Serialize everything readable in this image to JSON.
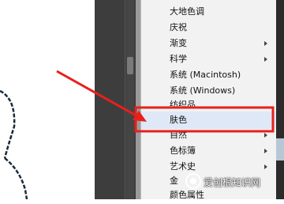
{
  "menu": {
    "items": [
      {
        "label": "大地色调",
        "submenu": false,
        "highlighted": false
      },
      {
        "label": "庆祝",
        "submenu": false,
        "highlighted": false
      },
      {
        "label": "渐变",
        "submenu": true,
        "highlighted": false
      },
      {
        "label": "科学",
        "submenu": true,
        "highlighted": false
      },
      {
        "label": "系统 (Macintosh)",
        "submenu": false,
        "highlighted": false
      },
      {
        "label": "系统 (Windows)",
        "submenu": false,
        "highlighted": false
      },
      {
        "label": "纺织品",
        "submenu": false,
        "highlighted": false
      },
      {
        "label": "肤色",
        "submenu": false,
        "highlighted": true
      },
      {
        "label": "自然",
        "submenu": true,
        "highlighted": false
      },
      {
        "label": "色标簿",
        "submenu": true,
        "highlighted": false
      },
      {
        "label": "艺术史",
        "submenu": true,
        "highlighted": false
      },
      {
        "label": "金",
        "submenu": false,
        "highlighted": false
      },
      {
        "label": "颜色属性",
        "submenu": false,
        "highlighted": false
      }
    ]
  },
  "annotation": {
    "arrow_color": "#e8201c",
    "highlight_box_color": "#e8201c"
  },
  "watermark": {
    "text": "爱创根知识网"
  }
}
